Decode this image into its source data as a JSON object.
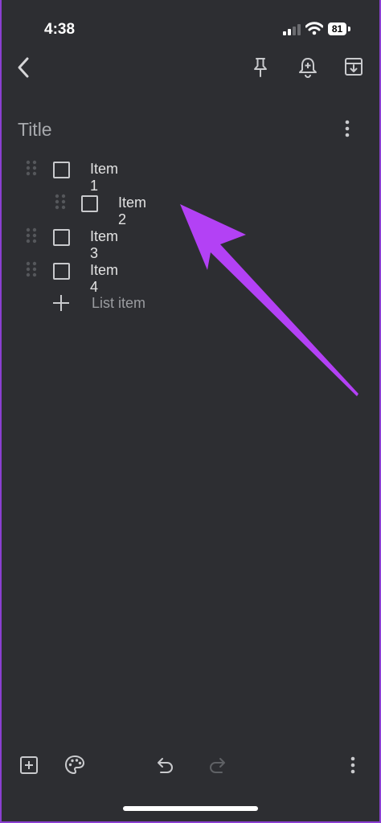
{
  "status_bar": {
    "time": "4:38",
    "battery": "81",
    "icons": [
      "cellular-signal-icon",
      "wifi-icon",
      "battery-icon"
    ]
  },
  "toolbar": {
    "icons": [
      "back-arrow-icon",
      "pin-icon",
      "add-reminder-icon",
      "archive-icon"
    ]
  },
  "note": {
    "title_placeholder": "Title",
    "items": [
      {
        "label": "Item 1",
        "checked": false,
        "indented": false
      },
      {
        "label": "Item 2",
        "checked": false,
        "indented": true
      },
      {
        "label": "Item 3",
        "checked": false,
        "indented": false
      },
      {
        "label": "Item 4",
        "checked": false,
        "indented": false
      }
    ],
    "add_item_placeholder": "List item"
  },
  "bottom_bar": {
    "icons": [
      "add-box-icon",
      "palette-icon",
      "undo-icon",
      "redo-icon",
      "more-options-icon"
    ]
  },
  "annotation": {
    "arrow_color": "#b341f5"
  },
  "colors": {
    "background": "#2d2e32",
    "frame_border": "#8a3fd1",
    "text": "#e3e3e3"
  }
}
